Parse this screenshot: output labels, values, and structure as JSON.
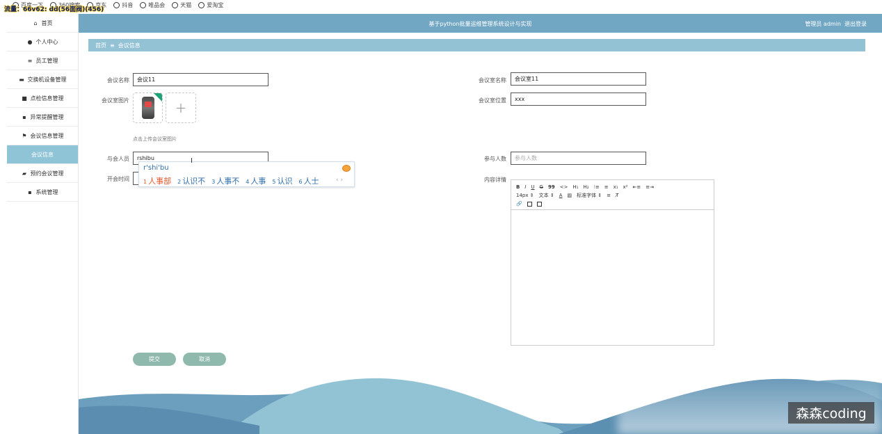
{
  "overlay_label": "流量：66v62: dd(56面阀)(456)",
  "bookmarks": [
    {
      "label": "百度一下"
    },
    {
      "label": "360搜索"
    },
    {
      "label": "京东"
    },
    {
      "label": "抖音"
    },
    {
      "label": "唯品会"
    },
    {
      "label": "天猫"
    },
    {
      "label": "爱淘宝"
    }
  ],
  "sidebar": {
    "items": [
      {
        "label": "首页",
        "icon": "home-icon",
        "glyph": "⌂"
      },
      {
        "label": "个人中心",
        "icon": "user-icon",
        "glyph": "●"
      },
      {
        "label": "员工管理",
        "icon": "list-icon",
        "glyph": "≡"
      },
      {
        "label": "交换机设备管理",
        "icon": "briefcase-icon",
        "glyph": "▬"
      },
      {
        "label": "点检信息管理",
        "icon": "camera-icon",
        "glyph": "■"
      },
      {
        "label": "异常提醒管理",
        "icon": "grid-icon",
        "glyph": "▪"
      },
      {
        "label": "会议信息管理",
        "icon": "flag-icon",
        "glyph": "⚑"
      },
      {
        "label": "会议信息",
        "icon": "",
        "glyph": ""
      },
      {
        "label": "预约会议管理",
        "icon": "folder-icon",
        "glyph": "▰"
      },
      {
        "label": "系统管理",
        "icon": "grid-icon",
        "glyph": "▪"
      }
    ]
  },
  "header": {
    "title": "基于python批量运维管理系统设计与实现",
    "user": "管理员 admin",
    "logout": "退出登录"
  },
  "breadcrumb": {
    "home": "首页",
    "sep": "≡",
    "current": "会议信息"
  },
  "form": {
    "meeting_name_label": "会议名称",
    "meeting_name_value": "会议11",
    "room_name_label": "会议室名称",
    "room_name_value": "会议室11",
    "room_image_label": "会议室图片",
    "room_location_label": "会议室位置",
    "room_location_value": "xxx",
    "upload_hint": "点击上传会议室图片",
    "attendees_label": "与会人员",
    "attendees_value": "rshibu",
    "count_label": "参与人数",
    "count_placeholder": "参与人数",
    "time_label": "开会时间",
    "detail_label": "内容详情",
    "submit": "提交",
    "cancel": "取消"
  },
  "ime": {
    "pinyin": "r'shi'bu",
    "candidates": [
      {
        "num": "1",
        "text": "人事部"
      },
      {
        "num": "2",
        "text": "认识不"
      },
      {
        "num": "3",
        "text": "人事不"
      },
      {
        "num": "4",
        "text": "人事"
      },
      {
        "num": "5",
        "text": "认识"
      },
      {
        "num": "6",
        "text": "人士"
      }
    ],
    "arrows": "‹ ›"
  },
  "editor_toolbar": {
    "row1": [
      "B",
      "I",
      "U",
      "G",
      "99",
      "<>",
      "H₁",
      "H₂",
      "⁝≡",
      "≡",
      "x₁",
      "x²",
      "⇤≡",
      "≡⇥"
    ],
    "size": "14px",
    "text_style": "文本",
    "font": "标准字体",
    "row2_icons": [
      "A",
      "▨",
      "≡",
      "T̸"
    ]
  },
  "watermark": "森森coding",
  "colors": {
    "header": "#72a7c4",
    "breadcrumb": "#93c2d5",
    "active_nav": "#8fc3d6",
    "button": "#8fb9ac"
  }
}
